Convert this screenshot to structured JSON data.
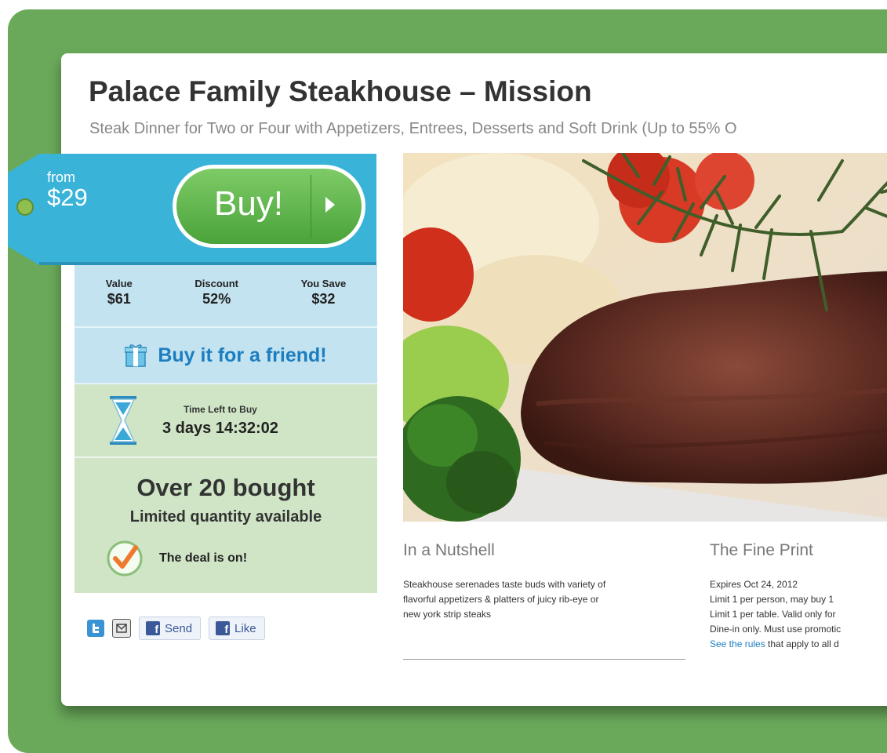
{
  "deal": {
    "title": "Palace Family Steakhouse – Mission",
    "subtitle": "Steak Dinner for Two or Four with Appetizers, Entrees, Desserts and Soft Drink (Up to 55% O"
  },
  "price_tag": {
    "from_label": "from",
    "price": "$29",
    "buy_label": "Buy!"
  },
  "stats": {
    "value_label": "Value",
    "value": "$61",
    "discount_label": "Discount",
    "discount": "52%",
    "save_label": "You Save",
    "save": "$32"
  },
  "gift": {
    "label": "Buy it for a friend!"
  },
  "timer": {
    "label": "Time Left to Buy",
    "value": "3 days 14:32:02"
  },
  "purchases": {
    "count": "Over 20 bought",
    "note": "Limited quantity available",
    "status": "The deal is on!"
  },
  "share": {
    "send_label": "Send",
    "like_label": "Like",
    "icons": [
      "twitter-icon",
      "email-icon",
      "facebook-icon"
    ]
  },
  "nutshell": {
    "heading": "In a Nutshell",
    "lines": [
      "Steakhouse serenades taste buds with variety of",
      "flavorful appetizers & platters of juicy rib-eye or",
      "new york strip steaks"
    ]
  },
  "fine_print": {
    "heading": "The Fine Print",
    "lines": [
      "Expires Oct 24, 2012",
      "Limit 1 per person, may buy 1",
      "Limit 1 per table. Valid only for",
      "Dine-in only. Must use promotic"
    ],
    "rules_link": "See the rules",
    "rules_tail": " that apply to all d"
  },
  "colors": {
    "frame_green": "#6aa95a",
    "tag_blue": "#39b3d8",
    "buy_green": "#5db84a",
    "link_blue": "#1c7dc0"
  }
}
